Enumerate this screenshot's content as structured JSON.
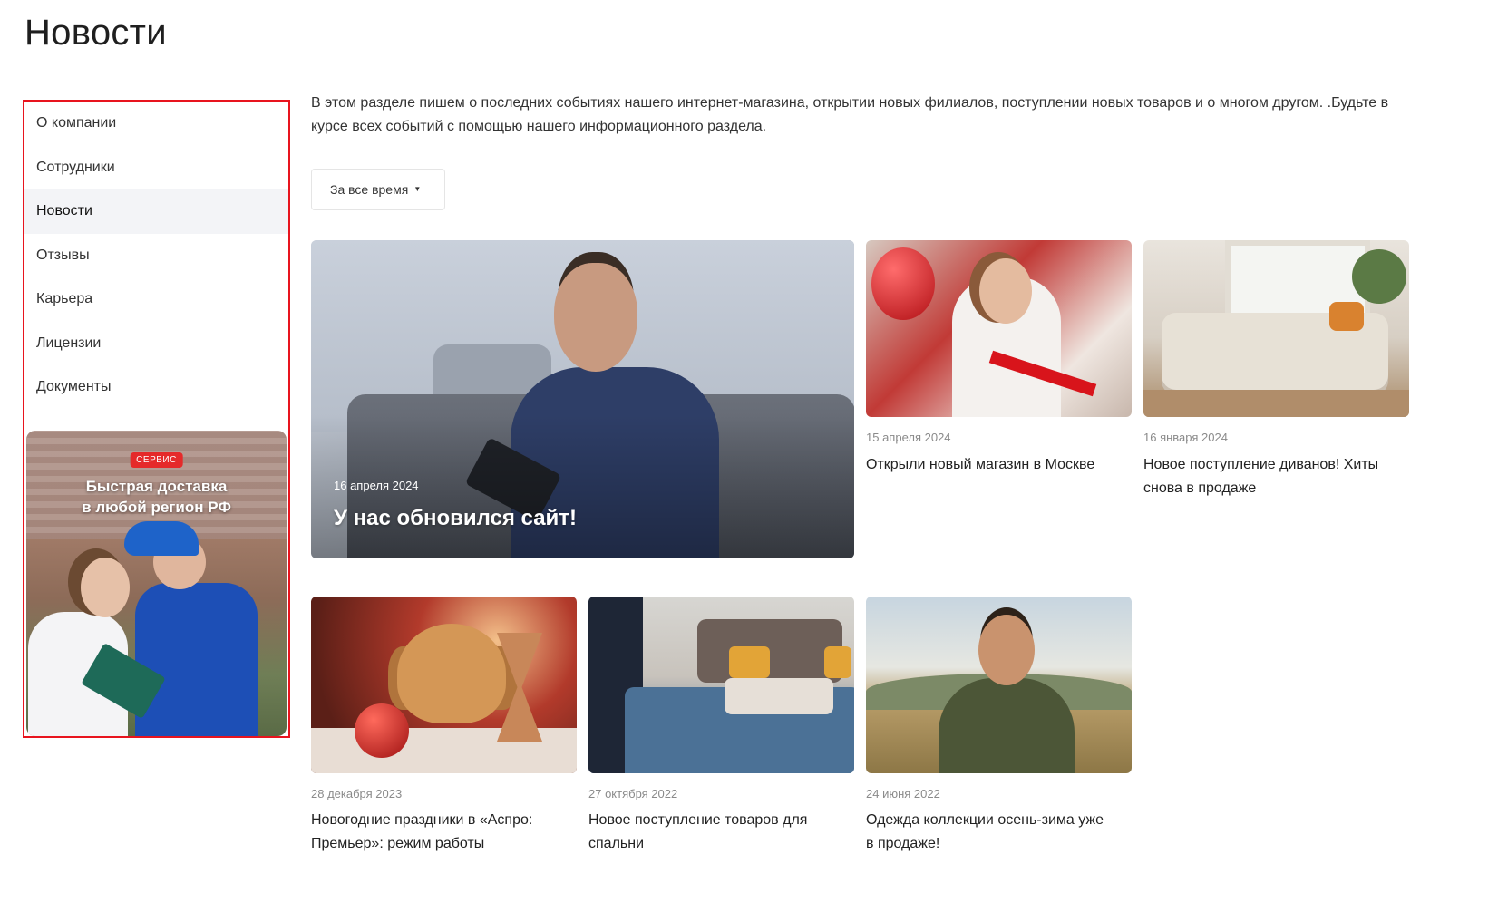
{
  "page": {
    "title": "Новости"
  },
  "sidebar": {
    "items": [
      {
        "label": "О компании"
      },
      {
        "label": "Сотрудники"
      },
      {
        "label": "Новости",
        "active": true
      },
      {
        "label": "Отзывы"
      },
      {
        "label": "Карьера"
      },
      {
        "label": "Лицензии"
      },
      {
        "label": "Документы"
      }
    ],
    "promo": {
      "badge": "СЕРВИС",
      "title_line1": "Быстрая доставка",
      "title_line2": "в любой регион РФ"
    }
  },
  "main": {
    "intro": "В этом разделе пишем о последних событиях нашего интернет-магазина, открытии новых филиалов, поступлении новых товаров и о многом другом. .Будьте в курсе всех событий с помощью нашего информационного раздела.",
    "filter": {
      "label": "За все время",
      "icon": "caret-down-icon"
    },
    "featured": {
      "date": "16 апреля 2024",
      "title": "У нас обновился сайт!"
    },
    "news": [
      {
        "date": "15 апреля 2024",
        "title": "Открыли новый магазин в Москве"
      },
      {
        "date": "16 января 2024",
        "title": "Новое поступление диванов! Хиты снова в продаже"
      },
      {
        "date": "28 декабря 2023",
        "title": "Новогодние праздники в «Аспро: Премьер»: режим работы"
      },
      {
        "date": "27 октября 2022",
        "title": "Новое поступление товаров для спальни"
      },
      {
        "date": "24 июня 2022",
        "title": "Одежда коллекции осень-зима уже в продаже!"
      }
    ]
  },
  "colors": {
    "highlight_border": "#e8141e",
    "active_menu_bg": "#f3f4f7",
    "badge_red": "#e52a2a",
    "date_gray": "#8a8a8a"
  }
}
